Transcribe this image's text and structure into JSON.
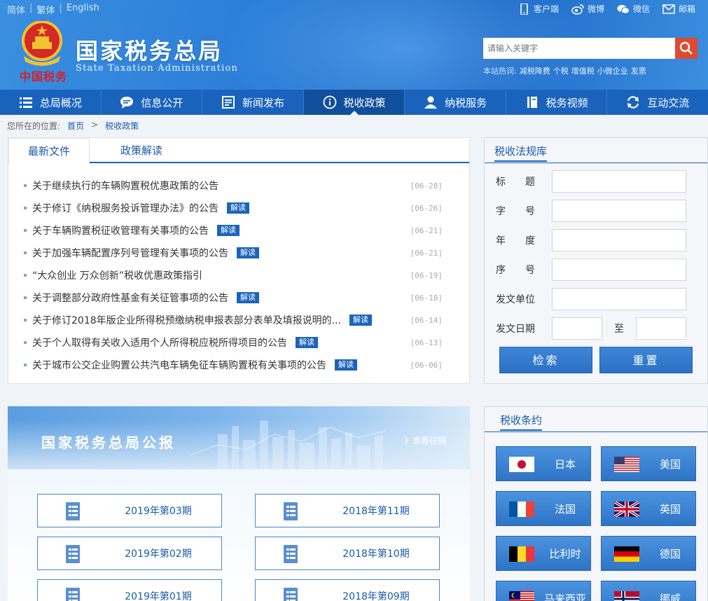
{
  "header": {
    "lang": [
      "简体",
      "繁体",
      "English"
    ],
    "toplinks": [
      "客户端",
      "微博",
      "微信",
      "邮箱"
    ],
    "brand_script": "中国税务",
    "title": "国家税务总局",
    "subtitle": "State Taxation Administration",
    "search_placeholder": "请输入关键字",
    "hot_label": "本站热词:",
    "hot_words": [
      "减税降费",
      "个税",
      "增值税",
      "小微企业",
      "发票"
    ]
  },
  "nav": [
    "总局概况",
    "信息公开",
    "新闻发布",
    "税收政策",
    "纳税服务",
    "税务视频",
    "互动交流"
  ],
  "breadcrumb": {
    "label": "您所在的位置:",
    "home": "首页",
    "sep": ">",
    "current": "税收政策"
  },
  "news": {
    "tabs": [
      "最新文件",
      "政策解读"
    ],
    "items": [
      {
        "title": "关于继续执行的车辆购置税优惠政策的公告",
        "badge": "",
        "date": "[06-28]"
      },
      {
        "title": "关于修订《纳税服务投诉管理办法》的公告",
        "badge": "解读",
        "date": "[06-26]"
      },
      {
        "title": "关于车辆购置税征收管理有关事项的公告",
        "badge": "解读",
        "date": "[06-21]"
      },
      {
        "title": "关于加强车辆配置序列号管理有关事项的公告",
        "badge": "解读",
        "date": "[06-21]"
      },
      {
        "title": "“大众创业 万众创新”税收优惠政策指引",
        "badge": "",
        "date": "[06-19]"
      },
      {
        "title": "关于调整部分政府性基金有关征管事项的公告",
        "badge": "解读",
        "date": "[06-18]"
      },
      {
        "title": "关于修订2018年版企业所得税预缴纳税申报表部分表单及填报说明的...",
        "badge": "解读",
        "date": "[06-14]"
      },
      {
        "title": "关于个人取得有关收入适用个人所得税应税所得项目的公告",
        "badge": "解读",
        "date": "[06-13]"
      },
      {
        "title": "关于城市公交企业购置公共汽电车辆免征车辆购置税有关事项的公告",
        "badge": "解读",
        "date": "[06-06]"
      }
    ]
  },
  "law": {
    "title": "税收法规库",
    "fields": [
      "标　　题",
      "字　　号",
      "年　　度",
      "序　　号",
      "发文单位",
      "发文日期"
    ],
    "to": "至",
    "search": "检索",
    "reset": "重置"
  },
  "bulletin": {
    "title": "国家税务总局公报",
    "more": "》查看往期",
    "issues": [
      "2019年第03期",
      "2018年第11期",
      "2019年第02期",
      "2018年第10期",
      "2019年第01期",
      "2018年第09期"
    ]
  },
  "treaty": {
    "title": "税收条约",
    "countries": [
      "日本",
      "美国",
      "法国",
      "英国",
      "比利时",
      "德国",
      "马来西亚",
      "挪威"
    ]
  },
  "colors": {
    "nav": "#1a63bd",
    "accent": "#e04a2c",
    "badge": "#1a63bd"
  }
}
